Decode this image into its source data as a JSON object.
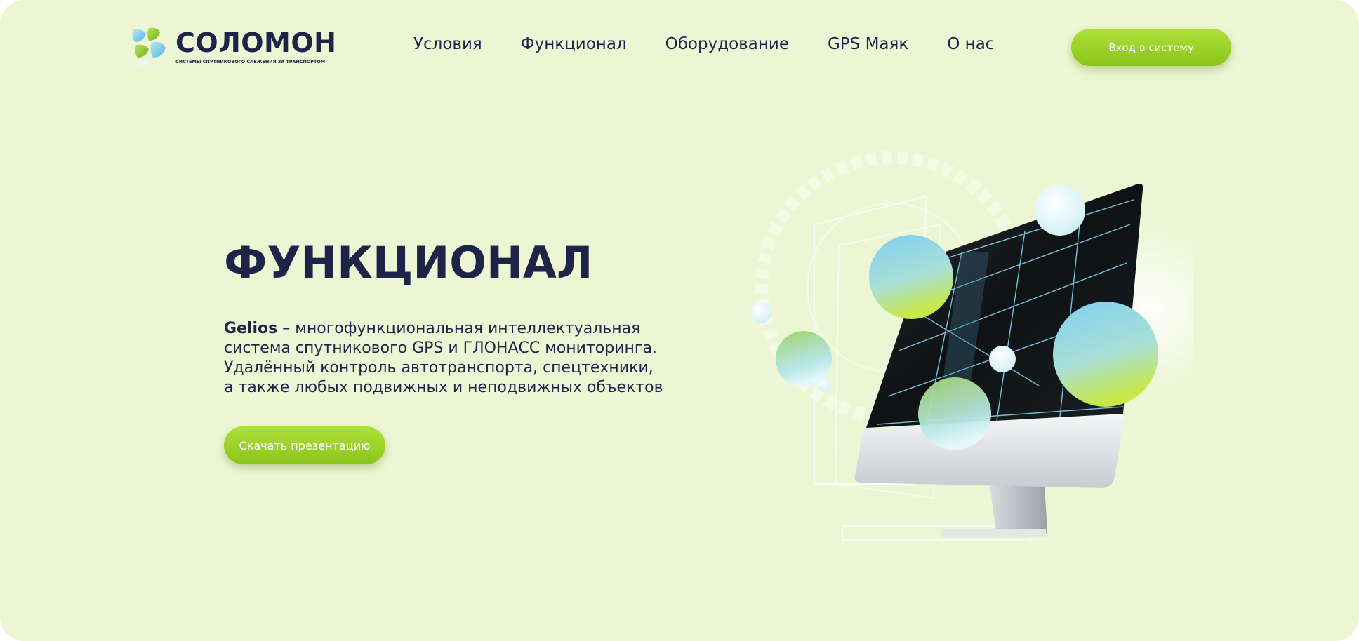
{
  "brand": {
    "name": "СОЛОМОН",
    "tagline": "СИСТЕМЫ СПУТНИКОВОГО СЛЕЖЕНИЯ ЗА ТРАНСПОРТОМ",
    "logo_icon": "leaf-cluster-logo-icon"
  },
  "nav": {
    "items": [
      {
        "label": "Условия"
      },
      {
        "label": "Функционал"
      },
      {
        "label": "Оборудование"
      },
      {
        "label": "GPS Маяк"
      },
      {
        "label": "О нас"
      }
    ]
  },
  "header": {
    "login_label": "Вход в систему"
  },
  "hero": {
    "title": "ФУНКЦИОНАЛ",
    "desc_brand": "Gelios",
    "desc_line1_rest": " – многофункциональная интеллектуальная",
    "desc_line2": "система спутникового GPS и ГЛОНАСС мониторинга.",
    "desc_line3": "Удалённый контроль автотранспорта, спецтехники,",
    "desc_line4": "а также любых подвижных и неподвижных объектов",
    "download_label": "Скачать презентацию",
    "illustration_icon": "monitor-with-spheres-illustration"
  },
  "colors": {
    "background": "#edf6d4",
    "text": "#1d2448",
    "accent_green": "#9fd42a",
    "accent_blue": "#6ec6ea"
  }
}
